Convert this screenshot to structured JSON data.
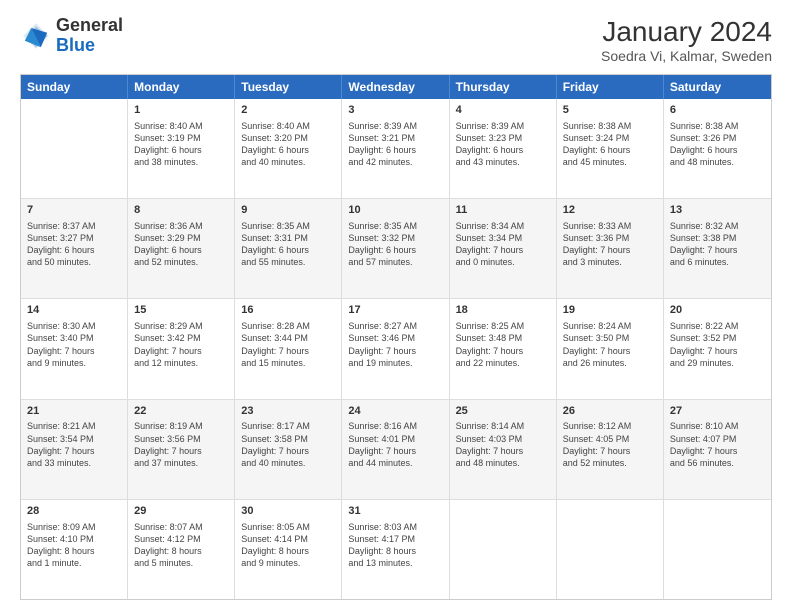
{
  "logo": {
    "general": "General",
    "blue": "Blue"
  },
  "title": "January 2024",
  "subtitle": "Soedra Vi, Kalmar, Sweden",
  "header_days": [
    "Sunday",
    "Monday",
    "Tuesday",
    "Wednesday",
    "Thursday",
    "Friday",
    "Saturday"
  ],
  "rows": [
    [
      {
        "num": "",
        "lines": []
      },
      {
        "num": "1",
        "lines": [
          "Sunrise: 8:40 AM",
          "Sunset: 3:19 PM",
          "Daylight: 6 hours",
          "and 38 minutes."
        ]
      },
      {
        "num": "2",
        "lines": [
          "Sunrise: 8:40 AM",
          "Sunset: 3:20 PM",
          "Daylight: 6 hours",
          "and 40 minutes."
        ]
      },
      {
        "num": "3",
        "lines": [
          "Sunrise: 8:39 AM",
          "Sunset: 3:21 PM",
          "Daylight: 6 hours",
          "and 42 minutes."
        ]
      },
      {
        "num": "4",
        "lines": [
          "Sunrise: 8:39 AM",
          "Sunset: 3:23 PM",
          "Daylight: 6 hours",
          "and 43 minutes."
        ]
      },
      {
        "num": "5",
        "lines": [
          "Sunrise: 8:38 AM",
          "Sunset: 3:24 PM",
          "Daylight: 6 hours",
          "and 45 minutes."
        ]
      },
      {
        "num": "6",
        "lines": [
          "Sunrise: 8:38 AM",
          "Sunset: 3:26 PM",
          "Daylight: 6 hours",
          "and 48 minutes."
        ]
      }
    ],
    [
      {
        "num": "7",
        "lines": [
          "Sunrise: 8:37 AM",
          "Sunset: 3:27 PM",
          "Daylight: 6 hours",
          "and 50 minutes."
        ]
      },
      {
        "num": "8",
        "lines": [
          "Sunrise: 8:36 AM",
          "Sunset: 3:29 PM",
          "Daylight: 6 hours",
          "and 52 minutes."
        ]
      },
      {
        "num": "9",
        "lines": [
          "Sunrise: 8:35 AM",
          "Sunset: 3:31 PM",
          "Daylight: 6 hours",
          "and 55 minutes."
        ]
      },
      {
        "num": "10",
        "lines": [
          "Sunrise: 8:35 AM",
          "Sunset: 3:32 PM",
          "Daylight: 6 hours",
          "and 57 minutes."
        ]
      },
      {
        "num": "11",
        "lines": [
          "Sunrise: 8:34 AM",
          "Sunset: 3:34 PM",
          "Daylight: 7 hours",
          "and 0 minutes."
        ]
      },
      {
        "num": "12",
        "lines": [
          "Sunrise: 8:33 AM",
          "Sunset: 3:36 PM",
          "Daylight: 7 hours",
          "and 3 minutes."
        ]
      },
      {
        "num": "13",
        "lines": [
          "Sunrise: 8:32 AM",
          "Sunset: 3:38 PM",
          "Daylight: 7 hours",
          "and 6 minutes."
        ]
      }
    ],
    [
      {
        "num": "14",
        "lines": [
          "Sunrise: 8:30 AM",
          "Sunset: 3:40 PM",
          "Daylight: 7 hours",
          "and 9 minutes."
        ]
      },
      {
        "num": "15",
        "lines": [
          "Sunrise: 8:29 AM",
          "Sunset: 3:42 PM",
          "Daylight: 7 hours",
          "and 12 minutes."
        ]
      },
      {
        "num": "16",
        "lines": [
          "Sunrise: 8:28 AM",
          "Sunset: 3:44 PM",
          "Daylight: 7 hours",
          "and 15 minutes."
        ]
      },
      {
        "num": "17",
        "lines": [
          "Sunrise: 8:27 AM",
          "Sunset: 3:46 PM",
          "Daylight: 7 hours",
          "and 19 minutes."
        ]
      },
      {
        "num": "18",
        "lines": [
          "Sunrise: 8:25 AM",
          "Sunset: 3:48 PM",
          "Daylight: 7 hours",
          "and 22 minutes."
        ]
      },
      {
        "num": "19",
        "lines": [
          "Sunrise: 8:24 AM",
          "Sunset: 3:50 PM",
          "Daylight: 7 hours",
          "and 26 minutes."
        ]
      },
      {
        "num": "20",
        "lines": [
          "Sunrise: 8:22 AM",
          "Sunset: 3:52 PM",
          "Daylight: 7 hours",
          "and 29 minutes."
        ]
      }
    ],
    [
      {
        "num": "21",
        "lines": [
          "Sunrise: 8:21 AM",
          "Sunset: 3:54 PM",
          "Daylight: 7 hours",
          "and 33 minutes."
        ]
      },
      {
        "num": "22",
        "lines": [
          "Sunrise: 8:19 AM",
          "Sunset: 3:56 PM",
          "Daylight: 7 hours",
          "and 37 minutes."
        ]
      },
      {
        "num": "23",
        "lines": [
          "Sunrise: 8:17 AM",
          "Sunset: 3:58 PM",
          "Daylight: 7 hours",
          "and 40 minutes."
        ]
      },
      {
        "num": "24",
        "lines": [
          "Sunrise: 8:16 AM",
          "Sunset: 4:01 PM",
          "Daylight: 7 hours",
          "and 44 minutes."
        ]
      },
      {
        "num": "25",
        "lines": [
          "Sunrise: 8:14 AM",
          "Sunset: 4:03 PM",
          "Daylight: 7 hours",
          "and 48 minutes."
        ]
      },
      {
        "num": "26",
        "lines": [
          "Sunrise: 8:12 AM",
          "Sunset: 4:05 PM",
          "Daylight: 7 hours",
          "and 52 minutes."
        ]
      },
      {
        "num": "27",
        "lines": [
          "Sunrise: 8:10 AM",
          "Sunset: 4:07 PM",
          "Daylight: 7 hours",
          "and 56 minutes."
        ]
      }
    ],
    [
      {
        "num": "28",
        "lines": [
          "Sunrise: 8:09 AM",
          "Sunset: 4:10 PM",
          "Daylight: 8 hours",
          "and 1 minute."
        ]
      },
      {
        "num": "29",
        "lines": [
          "Sunrise: 8:07 AM",
          "Sunset: 4:12 PM",
          "Daylight: 8 hours",
          "and 5 minutes."
        ]
      },
      {
        "num": "30",
        "lines": [
          "Sunrise: 8:05 AM",
          "Sunset: 4:14 PM",
          "Daylight: 8 hours",
          "and 9 minutes."
        ]
      },
      {
        "num": "31",
        "lines": [
          "Sunrise: 8:03 AM",
          "Sunset: 4:17 PM",
          "Daylight: 8 hours",
          "and 13 minutes."
        ]
      },
      {
        "num": "",
        "lines": []
      },
      {
        "num": "",
        "lines": []
      },
      {
        "num": "",
        "lines": []
      }
    ]
  ]
}
